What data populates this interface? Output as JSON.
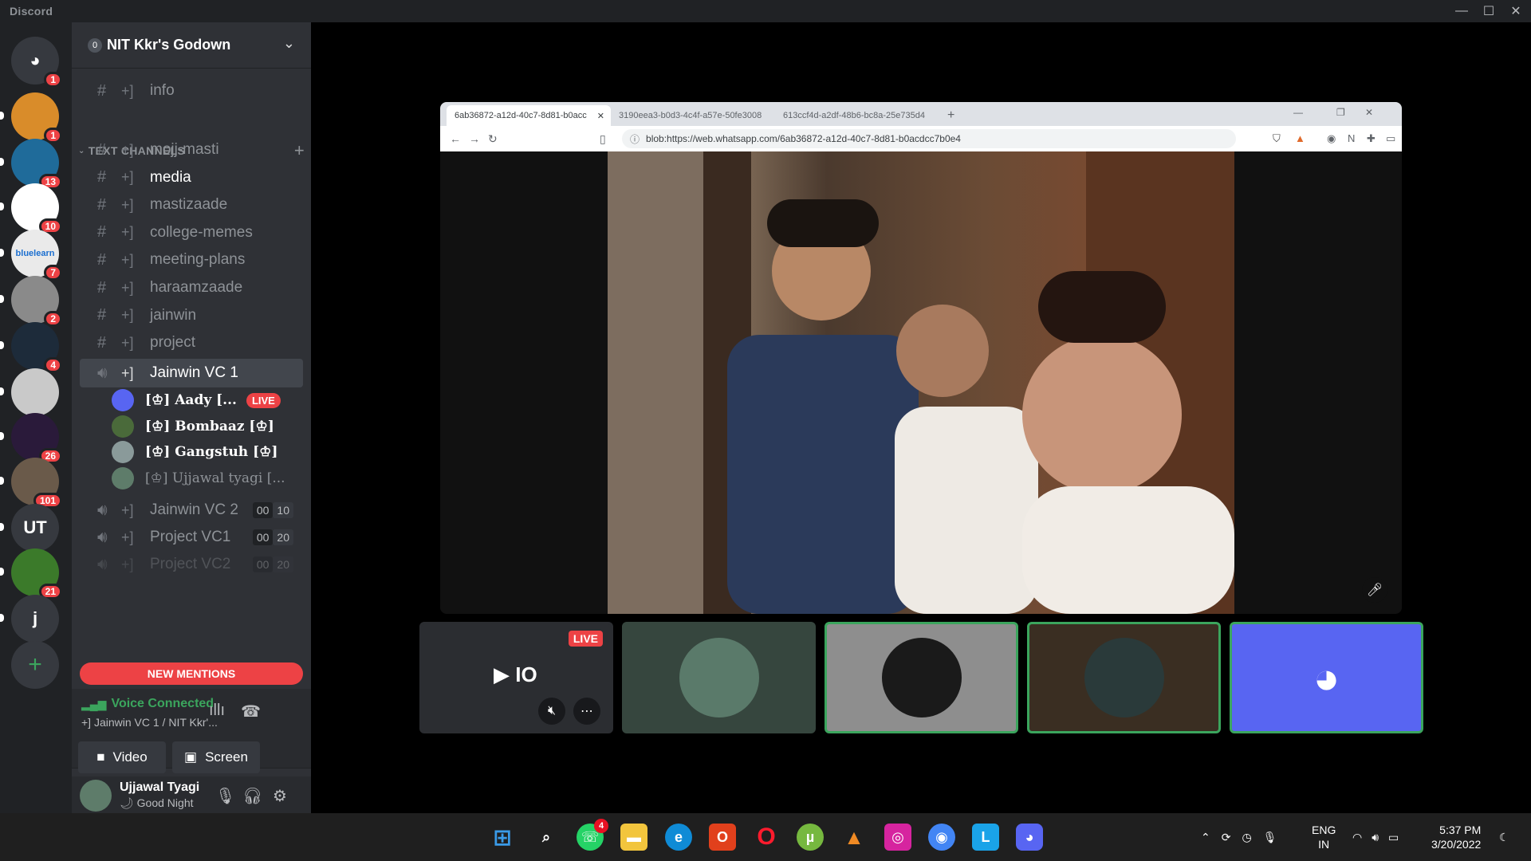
{
  "window": {
    "app_title": "Discord",
    "controls": [
      "—",
      "☐",
      "✕"
    ]
  },
  "servers": [
    {
      "name": "home",
      "label": "",
      "badge": "1",
      "color": "#36393f"
    },
    {
      "name": "server-2",
      "label": "",
      "badge": "1",
      "color": "#d98c2a"
    },
    {
      "name": "server-3",
      "label": "",
      "badge": "13",
      "color": "#1f6b9a"
    },
    {
      "name": "server-4",
      "label": "",
      "badge": "10",
      "color": "#ffffff"
    },
    {
      "name": "server-5",
      "label": "bluelearn",
      "badge": "7",
      "color": "#eaeaea"
    },
    {
      "name": "server-6",
      "label": "",
      "badge": "2",
      "color": "#8a8a8a"
    },
    {
      "name": "server-7",
      "label": "",
      "badge": "4",
      "color": "#1d2b3a"
    },
    {
      "name": "server-8",
      "label": "",
      "badge": "",
      "color": "#c9c9c9"
    },
    {
      "name": "server-9",
      "label": "",
      "badge": "26",
      "color": "#2a1a3a"
    },
    {
      "name": "server-10",
      "label": "",
      "badge": "101",
      "color": "#6a5a4a"
    },
    {
      "name": "server-11",
      "label": "UT",
      "badge": "",
      "color": "#36393f"
    },
    {
      "name": "server-12",
      "label": "",
      "badge": "21",
      "color": "#3b7a2a"
    },
    {
      "name": "server-13",
      "label": "j",
      "badge": "",
      "color": "#36393f"
    },
    {
      "name": "add-server",
      "label": "+",
      "badge": "",
      "color": "#36393f"
    }
  ],
  "guild": {
    "icon_text": "0",
    "name": "NIT Kkr's Godown"
  },
  "top_channel": {
    "prefix": "#  +]",
    "name": "info"
  },
  "category": {
    "name": "TEXT CHANNELS"
  },
  "channels": [
    {
      "name": "mojj-masti"
    },
    {
      "name": "media"
    },
    {
      "name": "mastizaade"
    },
    {
      "name": "college-memes"
    },
    {
      "name": "meeting-plans"
    },
    {
      "name": "haraamzaade"
    },
    {
      "name": "jainwin"
    },
    {
      "name": "project"
    }
  ],
  "voice_channel": {
    "name": "Jainwin VC 1"
  },
  "voice_users": [
    {
      "name": "[♔] Aady [...",
      "live": "LIVE",
      "color": "#5865f2"
    },
    {
      "name": "[♔] Bombaaz [♔]",
      "live": "",
      "color": "#4a6a3a"
    },
    {
      "name": "[♔] Gangstuh [♔]",
      "live": "",
      "color": "#8a9a9a"
    },
    {
      "name": "[♔] Ujjawal tyagi [...",
      "live": "",
      "color": "#5e7c6a"
    }
  ],
  "other_voice": [
    {
      "name": "Jainwin VC 2",
      "count_a": "00",
      "count_b": "10"
    },
    {
      "name": "Project VC1",
      "count_a": "00",
      "count_b": "20"
    },
    {
      "name": "Project VC2",
      "count_a": "00",
      "count_b": "20"
    }
  ],
  "mentions_label": "NEW MENTIONS",
  "voice_panel": {
    "status": "Voice Connected",
    "sub": "Jainwin VC 1 / NIT Kkr'...",
    "video_label": "Video",
    "screen_label": "Screen"
  },
  "user": {
    "name": "Ujjawal Tyagi",
    "status": "Good Night"
  },
  "browser": {
    "tabs": [
      {
        "title": "6ab36872-a12d-40c7-8d81-b0acc"
      },
      {
        "title": "3190eea3-b0d3-4c4f-a57e-50fe3008"
      },
      {
        "title": "613ccf4d-a2df-48b6-bc8a-25e735d4"
      }
    ],
    "url": "blob:https://web.whatsapp.com/6ab36872-a12d-40c7-8d81-b0acdcc7b0e4"
  },
  "stream_tiles": [
    {
      "name": "aady-stream",
      "live": "LIVE",
      "bg": "#2b2d31",
      "border": "#2b2d31"
    },
    {
      "name": "bombaaz-tile",
      "live": "",
      "bg": "#36463e",
      "border": "#36463e"
    },
    {
      "name": "anonymous-tile",
      "live": "",
      "bg": "#8e8e8e",
      "border": "#3ba55d"
    },
    {
      "name": "chess-tile",
      "live": "",
      "bg": "#3a2e22",
      "border": "#3ba55d"
    },
    {
      "name": "discord-tile",
      "live": "",
      "bg": "#5865f2",
      "border": "#3ba55d"
    }
  ],
  "taskbar": {
    "whatsapp_badge": "4",
    "lang_top": "ENG",
    "lang_bottom": "IN",
    "time": "5:37 PM",
    "date": "3/20/2022"
  }
}
